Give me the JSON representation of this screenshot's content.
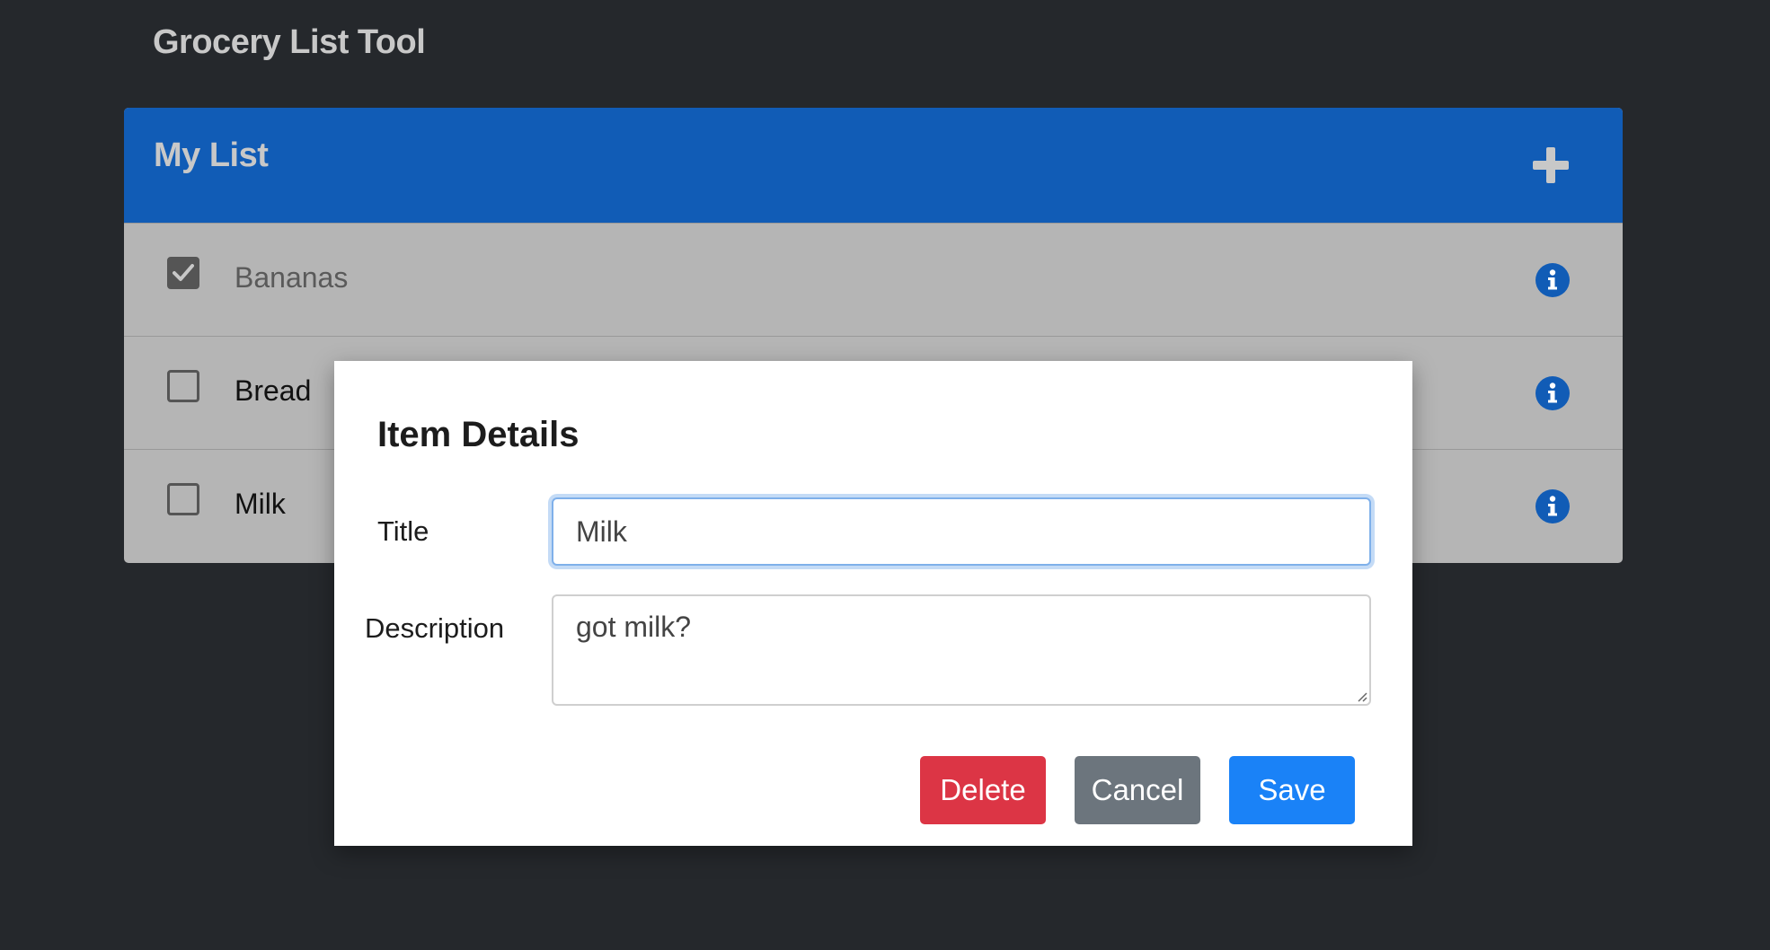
{
  "app": {
    "title": "Grocery List Tool"
  },
  "list": {
    "title": "My List",
    "add_icon": "plus-icon",
    "items": [
      {
        "label": "Bananas",
        "checked": true
      },
      {
        "label": "Bread",
        "checked": false
      },
      {
        "label": "Milk",
        "checked": false
      }
    ],
    "info_icon": "info-icon",
    "header_color": "#115cb6"
  },
  "modal": {
    "title": "Item Details",
    "title_label": "Title",
    "title_value": "Milk",
    "description_label": "Description",
    "description_value": "got milk?",
    "buttons": {
      "delete": "Delete",
      "cancel": "Cancel",
      "save": "Save"
    },
    "colors": {
      "delete": "#dc3545",
      "cancel": "#6c757d",
      "save": "#1a82f7"
    }
  }
}
